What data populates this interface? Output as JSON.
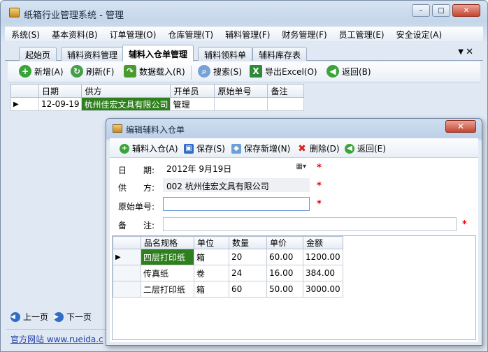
{
  "window": {
    "title": "纸箱行业管理系统 - 管理",
    "min": "–",
    "max": "□",
    "close": "✕"
  },
  "menu": [
    "系统(S)",
    "基本资料(B)",
    "订单管理(O)",
    "仓库管理(T)",
    "辅料管理(F)",
    "财务管理(F)",
    "员工管理(E)",
    "安全设定(A)"
  ],
  "tabs": [
    "起始页",
    "辅料资料管理",
    "辅料入仓单管理",
    "辅料领料单",
    "辅料库存表"
  ],
  "tab_controls": {
    "arrow": "▼",
    "close": "✕"
  },
  "toolbar": {
    "add": "新增(A)",
    "refresh": "刷新(F)",
    "load": "数据载入(R)",
    "search": "搜索(S)",
    "export": "导出Excel(O)",
    "back": "返回(B)"
  },
  "grid": {
    "headers": [
      "日期",
      "供方",
      "开单员",
      "原始单号",
      "备注"
    ],
    "rows": [
      {
        "date": "12-09-19",
        "supplier": "杭州佳宏文具有限公司",
        "clerk": "管理",
        "orig": "",
        "note": ""
      }
    ],
    "row_marker": "▶"
  },
  "pager": {
    "prev": "上一页",
    "next": "下一页"
  },
  "website": "官方网站 www.rueida.c",
  "dialog": {
    "title": "编辑辅料入仓单",
    "close": "✕",
    "toolbar": {
      "add_item": "辅料入仓(A)",
      "save": "保存(S)",
      "save_new": "保存新增(N)",
      "delete": "删除(D)",
      "back": "返回(E)"
    },
    "fields": {
      "date_label": "日　　期:",
      "date_value": "2012年 9月19日",
      "supplier_label": "供　　方:",
      "supplier_value": "002  杭州佳宏文具有限公司",
      "orig_label": "原始单号:",
      "orig_value": "",
      "note_label": "备　　注:",
      "note_value": ""
    },
    "required": "*",
    "items": {
      "headers": [
        "品名规格",
        "单位",
        "数量",
        "单价",
        "金额"
      ],
      "rows": [
        {
          "name": "四层打印纸",
          "unit": "箱",
          "qty": "20",
          "price": "60.00",
          "amount": "1200.00"
        },
        {
          "name": "传真纸",
          "unit": "卷",
          "qty": "24",
          "price": "16.00",
          "amount": "384.00"
        },
        {
          "name": "二层打印纸",
          "unit": "箱",
          "qty": "60",
          "price": "50.00",
          "amount": "3000.00"
        }
      ],
      "row_marker": "▶"
    }
  }
}
